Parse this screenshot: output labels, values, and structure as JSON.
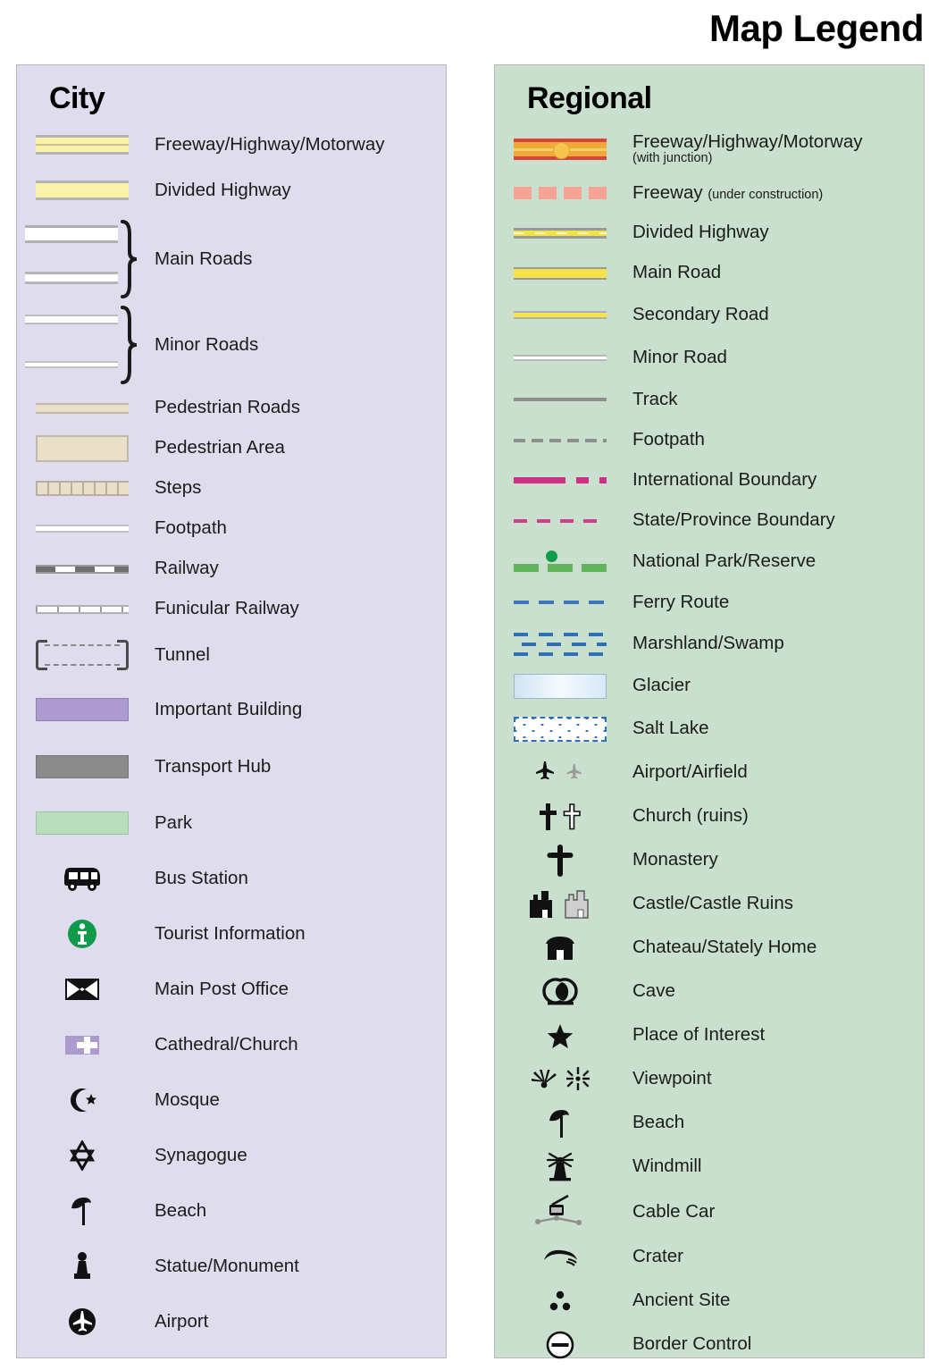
{
  "title": "Map Legend",
  "panels": {
    "city": {
      "heading": "City",
      "items": [
        {
          "label": "Freeway/Highway/Motorway",
          "icon": "freeway-swatch"
        },
        {
          "label": "Divided Highway",
          "icon": "divided-highway-swatch"
        },
        {
          "label": "Main Roads",
          "icon": "main-roads-swatch-brace"
        },
        {
          "label": "Minor Roads",
          "icon": "minor-roads-swatch-brace"
        },
        {
          "label": "Pedestrian Roads",
          "icon": "pedestrian-road-swatch"
        },
        {
          "label": "Pedestrian Area",
          "icon": "pedestrian-area-swatch"
        },
        {
          "label": "Steps",
          "icon": "steps-swatch"
        },
        {
          "label": "Footpath",
          "icon": "footpath-swatch"
        },
        {
          "label": "Railway",
          "icon": "railway-swatch"
        },
        {
          "label": "Funicular Railway",
          "icon": "funicular-railway-swatch"
        },
        {
          "label": "Tunnel",
          "icon": "tunnel-swatch"
        },
        {
          "label": "Important Building",
          "icon": "important-building-swatch"
        },
        {
          "label": "Transport Hub",
          "icon": "transport-hub-swatch"
        },
        {
          "label": "Park",
          "icon": "park-swatch"
        },
        {
          "label": "Bus Station",
          "icon": "bus-icon"
        },
        {
          "label": "Tourist Information",
          "icon": "information-icon"
        },
        {
          "label": "Main Post Office",
          "icon": "envelope-icon"
        },
        {
          "label": "Cathedral/Church",
          "icon": "cross-block-icon"
        },
        {
          "label": "Mosque",
          "icon": "crescent-star-icon"
        },
        {
          "label": "Synagogue",
          "icon": "star-of-david-icon"
        },
        {
          "label": "Beach",
          "icon": "parasol-icon"
        },
        {
          "label": "Statue/Monument",
          "icon": "statue-icon"
        },
        {
          "label": "Airport",
          "icon": "airplane-circle-icon"
        }
      ]
    },
    "regional": {
      "heading": "Regional",
      "items": [
        {
          "label": "Freeway/Highway/Motorway",
          "sub": "(with junction)",
          "icon": "freeway-junction-swatch"
        },
        {
          "label": "Freeway ",
          "inline": "(under construction)",
          "icon": "freeway-under-construction-swatch"
        },
        {
          "label": "Divided Highway",
          "icon": "divided-highway-swatch"
        },
        {
          "label": "Main Road",
          "icon": "main-road-swatch"
        },
        {
          "label": "Secondary Road",
          "icon": "secondary-road-swatch"
        },
        {
          "label": "Minor Road",
          "icon": "minor-road-swatch"
        },
        {
          "label": "Track",
          "icon": "track-swatch"
        },
        {
          "label": "Footpath",
          "icon": "footpath-swatch"
        },
        {
          "label": "International Boundary",
          "icon": "international-boundary-swatch"
        },
        {
          "label": "State/Province Boundary",
          "icon": "state-boundary-swatch"
        },
        {
          "label": "National Park/Reserve",
          "icon": "national-park-swatch"
        },
        {
          "label": "Ferry Route",
          "icon": "ferry-route-swatch"
        },
        {
          "label": "Marshland/Swamp",
          "icon": "marshland-swatch"
        },
        {
          "label": "Glacier",
          "icon": "glacier-swatch"
        },
        {
          "label": "Salt Lake",
          "icon": "salt-lake-swatch"
        },
        {
          "label": "Airport/Airfield",
          "icon": "airplane-pair-icon"
        },
        {
          "label": "Church (ruins)",
          "icon": "cross-pair-icon"
        },
        {
          "label": "Monastery",
          "icon": "monastery-cross-icon"
        },
        {
          "label": "Castle/Castle Ruins",
          "icon": "castle-pair-icon"
        },
        {
          "label": "Chateau/Stately Home",
          "icon": "chateau-icon"
        },
        {
          "label": "Cave",
          "icon": "cave-icon"
        },
        {
          "label": "Place of Interest",
          "icon": "star-icon"
        },
        {
          "label": "Viewpoint",
          "icon": "viewpoint-pair-icon"
        },
        {
          "label": "Beach",
          "icon": "parasol-icon"
        },
        {
          "label": "Windmill",
          "icon": "windmill-icon"
        },
        {
          "label": "Cable Car",
          "icon": "cable-car-icon"
        },
        {
          "label": "Crater",
          "icon": "crater-icon"
        },
        {
          "label": "Ancient Site",
          "icon": "ancient-site-icon"
        },
        {
          "label": "Border Control",
          "icon": "border-control-icon"
        }
      ]
    }
  },
  "colors": {
    "city_panel_bg": "#dedced",
    "regional_panel_bg": "#c8e0cd",
    "highway_yellow": "#faf2a8",
    "road_yellow": "#f7e24a",
    "freeway_red": "#d9443a",
    "freeway_orange": "#f2a93b",
    "boundary_magenta": "#cf2f86",
    "park_green": "#63b35e",
    "ferry_blue": "#3b75bd",
    "info_green": "#0f9b4a",
    "important_building_purple": "#ad9bd0",
    "transport_hub_gray": "#8b8b8b",
    "park_swatch_green": "#b7ddbd",
    "pedestrian_tan": "#e8dfc6"
  }
}
